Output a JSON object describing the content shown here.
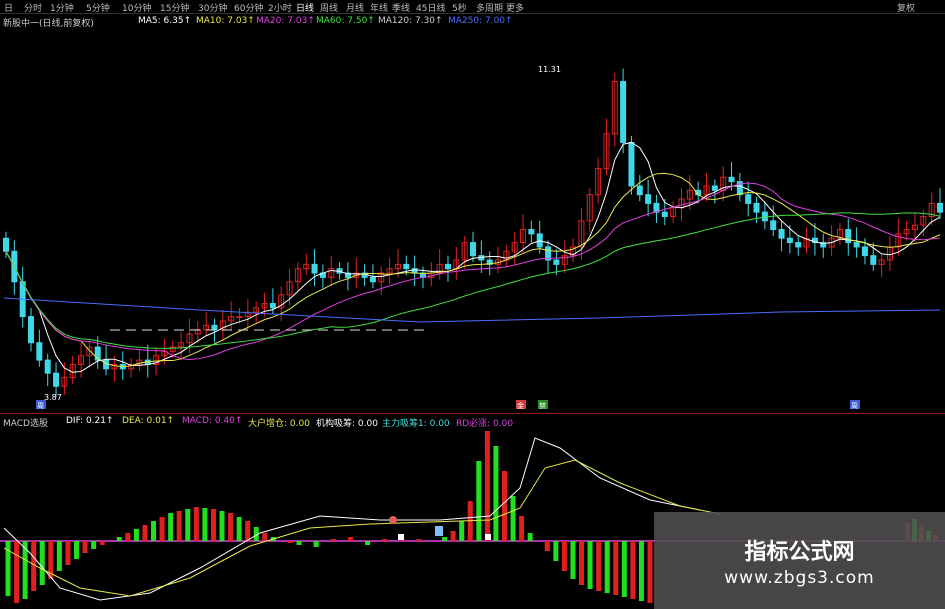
{
  "toolbar": {
    "items": [
      "日",
      "分时",
      "1分钟",
      "5分钟",
      "10分钟",
      "15分钟",
      "30分钟",
      "60分钟",
      "2小时",
      "日线",
      "周线",
      "月线",
      "年线",
      "季线",
      "45日线",
      "5秒",
      "多周期",
      "更多"
    ],
    "active_index": 9,
    "right_label": "复权"
  },
  "ma_legend": {
    "title": "新股中一(日线,前复权)",
    "items": [
      {
        "label": "MA5: 6.35↑",
        "color": "#ffffff"
      },
      {
        "label": "MA10: 7.03↑",
        "color": "#e8e84a"
      },
      {
        "label": "MA20: 7.03↑",
        "color": "#e040e0"
      },
      {
        "label": "MA60: 7.50↑",
        "color": "#40e040"
      },
      {
        "label": "MA120: 7.30↑",
        "color": "#cccccc"
      },
      {
        "label": "MA250: 7.00↑",
        "color": "#4a6cff"
      }
    ]
  },
  "macd_legend": {
    "title": "MACD选股",
    "items": [
      {
        "label": "DIF: 0.21↑",
        "color": "#ffffff"
      },
      {
        "label": "DEA: 0.01↑",
        "color": "#e8e84a"
      },
      {
        "label": "MACD: 0.40↑",
        "color": "#e040e0"
      },
      {
        "label": "大户增仓: 0.00",
        "color": "#e8e84a"
      },
      {
        "label": "机构吸筹: 0.00",
        "color": "#ffffff"
      },
      {
        "label": "主力吸筹1: 0.00",
        "color": "#40e0e0"
      },
      {
        "label": "RD必涨: 0.00",
        "color": "#e040e0"
      }
    ]
  },
  "annotations": {
    "high": "11.31",
    "low": "3.87",
    "markers": [
      "周",
      "金",
      "禁",
      "周"
    ]
  },
  "watermark": {
    "title": "指标公式网",
    "url": "www.zbgs3.com"
  },
  "colors": {
    "up": "#e02020",
    "down": "#40d8e8",
    "macd_up": "#e02020",
    "macd_down": "#20e020",
    "ma5": "#ffffff",
    "ma10": "#e8e84a",
    "ma20": "#e040e0",
    "ma60": "#40e040",
    "ma250": "#4a6cff",
    "zero_line": "#e040e0"
  }
}
